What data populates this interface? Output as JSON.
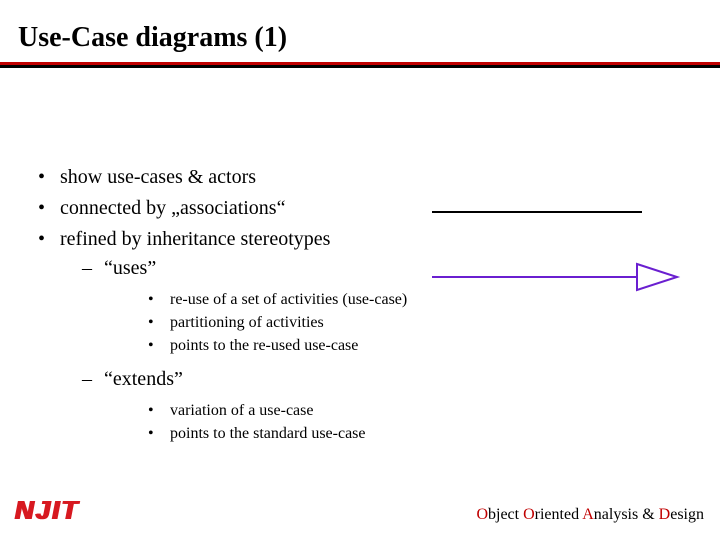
{
  "title": "Use-Case diagrams (1)",
  "bullets": {
    "b1": "show use-cases & actors",
    "b2": "connected by „associations“",
    "b3": "refined by inheritance stereotypes",
    "b3a": "“uses”",
    "b3a_subs": {
      "s1": "re-use of a set of activities (use-case)",
      "s2": "partitioning of activities",
      "s3": "points to the re-used use-case"
    },
    "b3b": "“extends”",
    "b3b_subs": {
      "s1": "variation of a use-case",
      "s2": "points to the standard use-case"
    }
  },
  "logo": "NJIT",
  "footer": {
    "o1": "O",
    "t1": "bject ",
    "o2": "O",
    "t2": "riented ",
    "a": "A",
    "t3": "nalysis & ",
    "d": "D",
    "t4": "esign"
  },
  "colors": {
    "rule_red": "#c00000",
    "accent_red": "#c00000",
    "logo_red": "#d71920",
    "arrow_purple": "#6a1fd0"
  }
}
